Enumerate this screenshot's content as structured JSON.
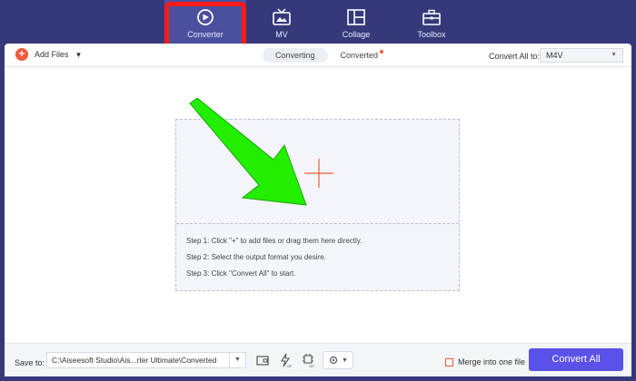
{
  "nav": {
    "tabs": [
      {
        "label": "Converter",
        "icon": "converter-icon",
        "active": true
      },
      {
        "label": "MV",
        "icon": "tv-icon",
        "active": false
      },
      {
        "label": "Collage",
        "icon": "collage-icon",
        "active": false
      },
      {
        "label": "Toolbox",
        "icon": "toolbox-icon",
        "active": false
      }
    ]
  },
  "toolbar": {
    "add_files": "Add Files",
    "tabs": [
      "Converting",
      "Converted"
    ],
    "convert_all_to": "Convert All to:",
    "format": "M4V"
  },
  "dropzone": {
    "steps": [
      "Step 1: Click \"+\" to add files or drag them here directly.",
      "Step 2: Select the output format you desire.",
      "Step 3: Click \"Convert All\" to start."
    ]
  },
  "bottom": {
    "save_to": "Save to:",
    "path": "C:\\Aiseesoft Studio\\Ais...rter Ultimate\\Converted",
    "merge_label": "Merge into one file",
    "convert_button": "Convert All"
  },
  "colors": {
    "header_bg": "#35397a",
    "accent": "#5a52e8",
    "add_orange": "#f15a3a",
    "highlight_red": "#ff1a1a",
    "arrow_green": "#22ee00"
  }
}
